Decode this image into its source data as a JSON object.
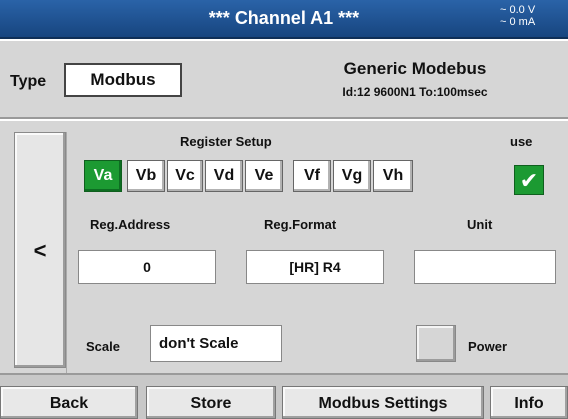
{
  "title_bar": {
    "title": "***  Channel A1  ***",
    "readout_line1": "~ 0.0 V",
    "readout_line2": "~ 0 mA",
    "color": "#1f5599"
  },
  "header": {
    "type_label": "Type",
    "type_value": "Modbus",
    "device_title": "Generic Modebus",
    "device_subtitle": "Id:12 9600N1 To:100msec"
  },
  "left_button": {
    "label": "<"
  },
  "register_setup": {
    "title": "Register Setup",
    "use_label": "use",
    "use_checked": true,
    "use_symbol": "✔",
    "tabs": [
      {
        "label": "Va",
        "active": true
      },
      {
        "label": "Vb",
        "active": false
      },
      {
        "label": "Vc",
        "active": false
      },
      {
        "label": "Vd",
        "active": false
      },
      {
        "label": "Ve",
        "active": false
      },
      {
        "label": "Vf",
        "active": false
      },
      {
        "label": "Vg",
        "active": false
      },
      {
        "label": "Vh",
        "active": false
      }
    ],
    "active_color": "#1c9a32"
  },
  "fields": {
    "reg_address_label": "Reg.Address",
    "reg_address_value": "0",
    "reg_format_label": "Reg.Format",
    "reg_format_value": "[HR] R4",
    "unit_label": "Unit",
    "unit_value": ""
  },
  "scale": {
    "label": "Scale",
    "value": "don't Scale"
  },
  "power": {
    "label": "Power",
    "checked": false
  },
  "bottom_buttons": {
    "back": "Back",
    "store": "Store",
    "modbus_settings": "Modbus Settings",
    "info": "Info"
  }
}
